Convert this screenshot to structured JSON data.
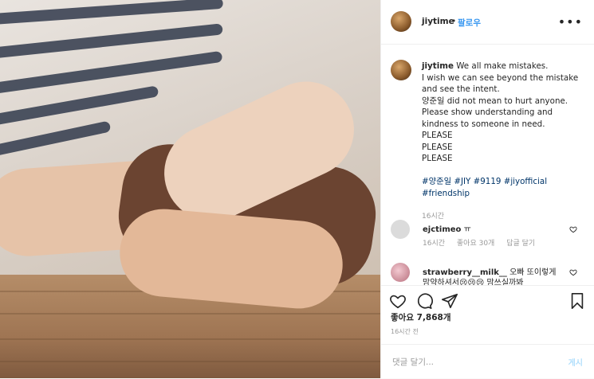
{
  "author": {
    "username": "jiytime",
    "separator": "•",
    "follow_label": "팔로우",
    "more_label": "•••"
  },
  "caption": {
    "lines": [
      "We all make mistakes.",
      "I wish we can see beyond the mistake",
      "and see the intent.",
      "양준일 did not mean to hurt anyone.",
      "Please show understanding and",
      "kindness to someone in need.",
      "PLEASE",
      "PLEASE",
      "PLEASE"
    ],
    "hashtags_line1": "#양준일 #JIY #9119 #jiyofficial",
    "hashtags_line2": "#friendship",
    "time": "16시간"
  },
  "comments": [
    {
      "username": "ejctimeo",
      "text": "ㅠ",
      "time": "16시간",
      "likes": "좋아요 30개",
      "reply_label": "답글 달기"
    },
    {
      "username": "strawberry__milk__",
      "text": "오빠 또이렇게",
      "text_line2": "맘약하셔서😢😢😢 맘쓰실까봐"
    }
  ],
  "likes_text": "좋아요 7,868개",
  "posted_time": "16시간 전",
  "add_comment": {
    "placeholder": "댓글 달기...",
    "post_label": "게시"
  },
  "colors": {
    "accent": "#3897f0",
    "hashtag": "#003569",
    "muted": "#999999",
    "post_disabled": "#b2dffc"
  },
  "icons": {
    "heart": "heart-icon",
    "comment": "comment-bubble-icon",
    "share": "paper-plane-icon",
    "save": "bookmark-icon"
  }
}
